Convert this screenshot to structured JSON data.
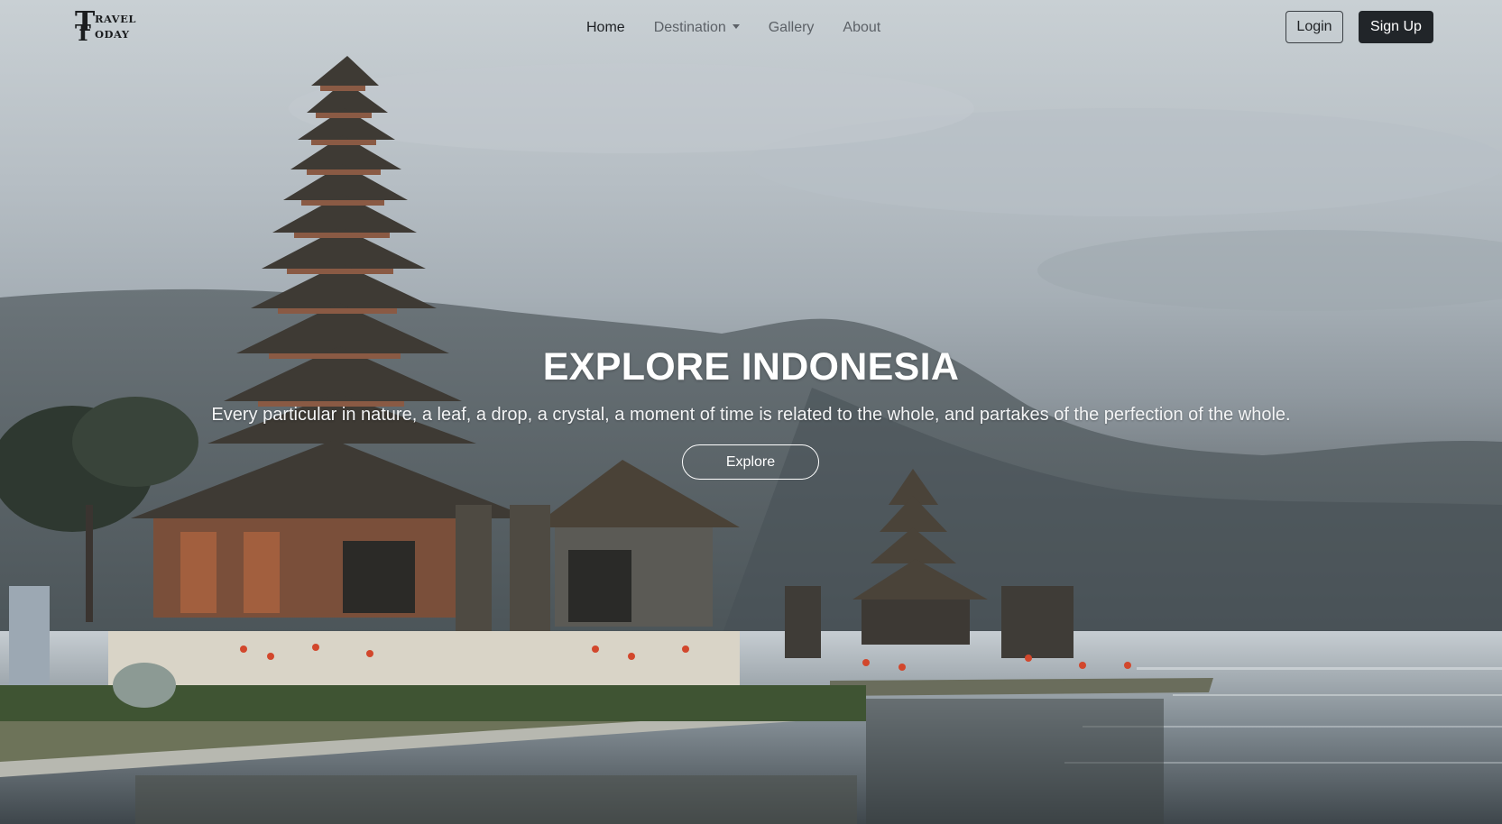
{
  "brand": {
    "logo_line1_big": "T",
    "logo_line1_small": "RAVEL",
    "logo_line2_big": "T",
    "logo_line2_small": "ODAY"
  },
  "nav": {
    "items": [
      {
        "label": "Home",
        "active": true
      },
      {
        "label": "Destination",
        "dropdown": true
      },
      {
        "label": "Gallery"
      },
      {
        "label": "About"
      }
    ]
  },
  "auth": {
    "login_label": "Login",
    "signup_label": "Sign Up"
  },
  "hero": {
    "title": "EXPLORE INDONESIA",
    "subtitle": "Every particular in nature, a leaf, a drop, a crystal, a moment of time is related to the whole, and partakes of the perfection of the whole.",
    "cta_label": "Explore"
  },
  "colors": {
    "accent_dark": "#212529",
    "text_muted": "#5c6167",
    "hero_text": "#ffffff"
  }
}
